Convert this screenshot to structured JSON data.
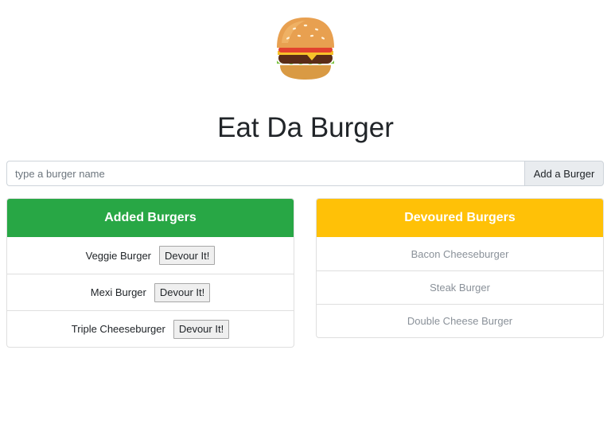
{
  "page": {
    "logo_icon": "hamburger-icon",
    "title": "Eat Da Burger"
  },
  "form": {
    "placeholder": "type a burger name",
    "value": "",
    "add_button_label": "Add a Burger"
  },
  "added": {
    "header": "Added Burgers",
    "header_color": "#28a745",
    "items": [
      {
        "name": "Veggie Burger",
        "button_label": "Devour It!"
      },
      {
        "name": "Mexi Burger",
        "button_label": "Devour It!"
      },
      {
        "name": "Triple Cheeseburger",
        "button_label": "Devour It!"
      }
    ]
  },
  "devoured": {
    "header": "Devoured Burgers",
    "header_color": "#ffc107",
    "items": [
      {
        "name": "Bacon Cheeseburger"
      },
      {
        "name": "Steak Burger"
      },
      {
        "name": "Double Cheese Burger"
      }
    ]
  }
}
